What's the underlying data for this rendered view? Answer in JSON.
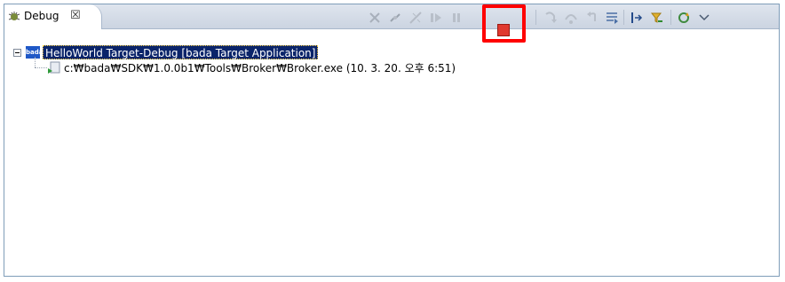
{
  "view": {
    "tab_title": "Debug",
    "tab_close": "☒"
  },
  "toolbar": {
    "icons": [
      "remove-terminated-icon",
      "disconnect-all-icon",
      "remove-all-terminated-icon",
      "resume-icon",
      "suspend-icon",
      "terminate-icon",
      "disconnect-icon",
      "step-into-icon",
      "step-over-icon",
      "step-return-icon",
      "drop-to-frame-icon",
      "instruction-stepping-icon",
      "use-step-filters-icon",
      "refresh-icon",
      "view-menu-icon"
    ],
    "highlighted": "terminate-icon"
  },
  "tree": {
    "root": {
      "label": "HelloWorld Target-Debug [bada Target Application]",
      "icon": "bada",
      "expanded": true
    },
    "child": {
      "label": "c:₩bada₩SDK₩1.0.0b1₩Tools₩Broker₩Broker.exe (10. 3. 20. 오후 6:51)"
    }
  },
  "colors": {
    "selection": "#0a246a",
    "highlight_box": "#ff0000",
    "terminate": "#e0392f"
  }
}
